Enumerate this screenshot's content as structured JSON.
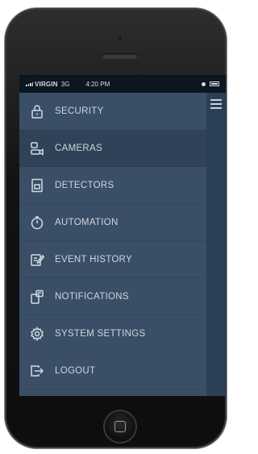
{
  "status_bar": {
    "carrier": "VIRGIN",
    "network": "3G",
    "time": "4:20 PM"
  },
  "menu": {
    "active_index": 1,
    "items": [
      {
        "label": "SECURITY",
        "icon": "lock-icon"
      },
      {
        "label": "CAMERAS",
        "icon": "camera-icon"
      },
      {
        "label": "DETECTORS",
        "icon": "detector-icon"
      },
      {
        "label": "AUTOMATION",
        "icon": "timer-icon"
      },
      {
        "label": "EVENT HISTORY",
        "icon": "edit-list-icon"
      },
      {
        "label": "NOTIFICATIONS",
        "icon": "notification-icon"
      },
      {
        "label": "SYSTEM SETTINGS",
        "icon": "gear-icon"
      },
      {
        "label": "LOGOUT",
        "icon": "logout-icon"
      }
    ]
  },
  "colors": {
    "menu_bg": "#3a4e66",
    "menu_active_bg": "#304257",
    "status_bar_bg": "#0c1620",
    "text": "#cfd6df"
  }
}
